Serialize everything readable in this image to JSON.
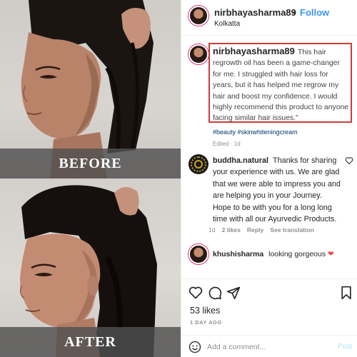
{
  "photo": {
    "before_label": "BEFORE",
    "after_label": "AFTER"
  },
  "header": {
    "username": "nirbhayasharma89",
    "separator": "•",
    "follow_label": "Follow",
    "location": "Kolkatta"
  },
  "caption": {
    "username": "nirbhayasharma89",
    "text": "This hair regrowth oil has been a game-changer for me. I struggled with hair loss for years, but it has helped me regrow my hair and boost my confidence. I would highly recommend this product to anyone facing similar hair issues.\"",
    "hashtags": "#beauty #skinwhiteningcream",
    "edited": "Edited · 1d",
    "highlight_color": "#d23a3a"
  },
  "comments": [
    {
      "username": "buddha.natural",
      "text": "Thanks for sharing your experience with us. We are glad that we were able to impress you and are helping you in your Journey. Hope to be with you for a long long time with all our Ayurvedic Products.",
      "time": "1d",
      "likes": "2 likes",
      "reply_label": "Reply",
      "translate_label": "See translation",
      "like_icon": "heart-outline-icon"
    },
    {
      "username": "khushisharma",
      "text": "looking gorgeous",
      "emoji": "❤"
    }
  ],
  "actions": {
    "icons": [
      "heart-icon",
      "comment-icon",
      "share-icon",
      "bookmark-icon"
    ]
  },
  "likes_count": "53 likes",
  "date": "1 DAY AGO",
  "add_comment": {
    "placeholder": "Add a comment...",
    "post_label": "Post",
    "emoji_icon": "smiley-icon"
  },
  "colors": {
    "link_blue": "#3897f0",
    "hashtag": "#00376b",
    "muted": "#8e8e8e",
    "heart": "#ed4956"
  }
}
